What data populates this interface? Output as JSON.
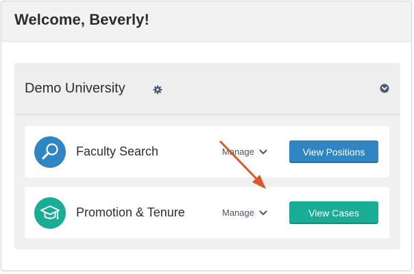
{
  "header": {
    "title": "Welcome, Beverly!"
  },
  "organization": {
    "name": "Demo University",
    "settings_icon": "gear-icon",
    "collapse_icon": "chevron-circle-down-icon"
  },
  "apps": [
    {
      "name": "Faculty Search",
      "icon": "magnifier-icon",
      "icon_color": "#2f86c2",
      "manage_label": "Manage",
      "button_label": "View Positions",
      "button_color": "#2f86c2"
    },
    {
      "name": "Promotion & Tenure",
      "icon": "graduation-cap-icon",
      "icon_color": "#19ad95",
      "manage_label": "Manage",
      "button_label": "View Cases",
      "button_color": "#19ad95"
    }
  ],
  "annotation": {
    "arrow_color": "#d9572b",
    "arrow_icon": "annotation-arrow"
  }
}
